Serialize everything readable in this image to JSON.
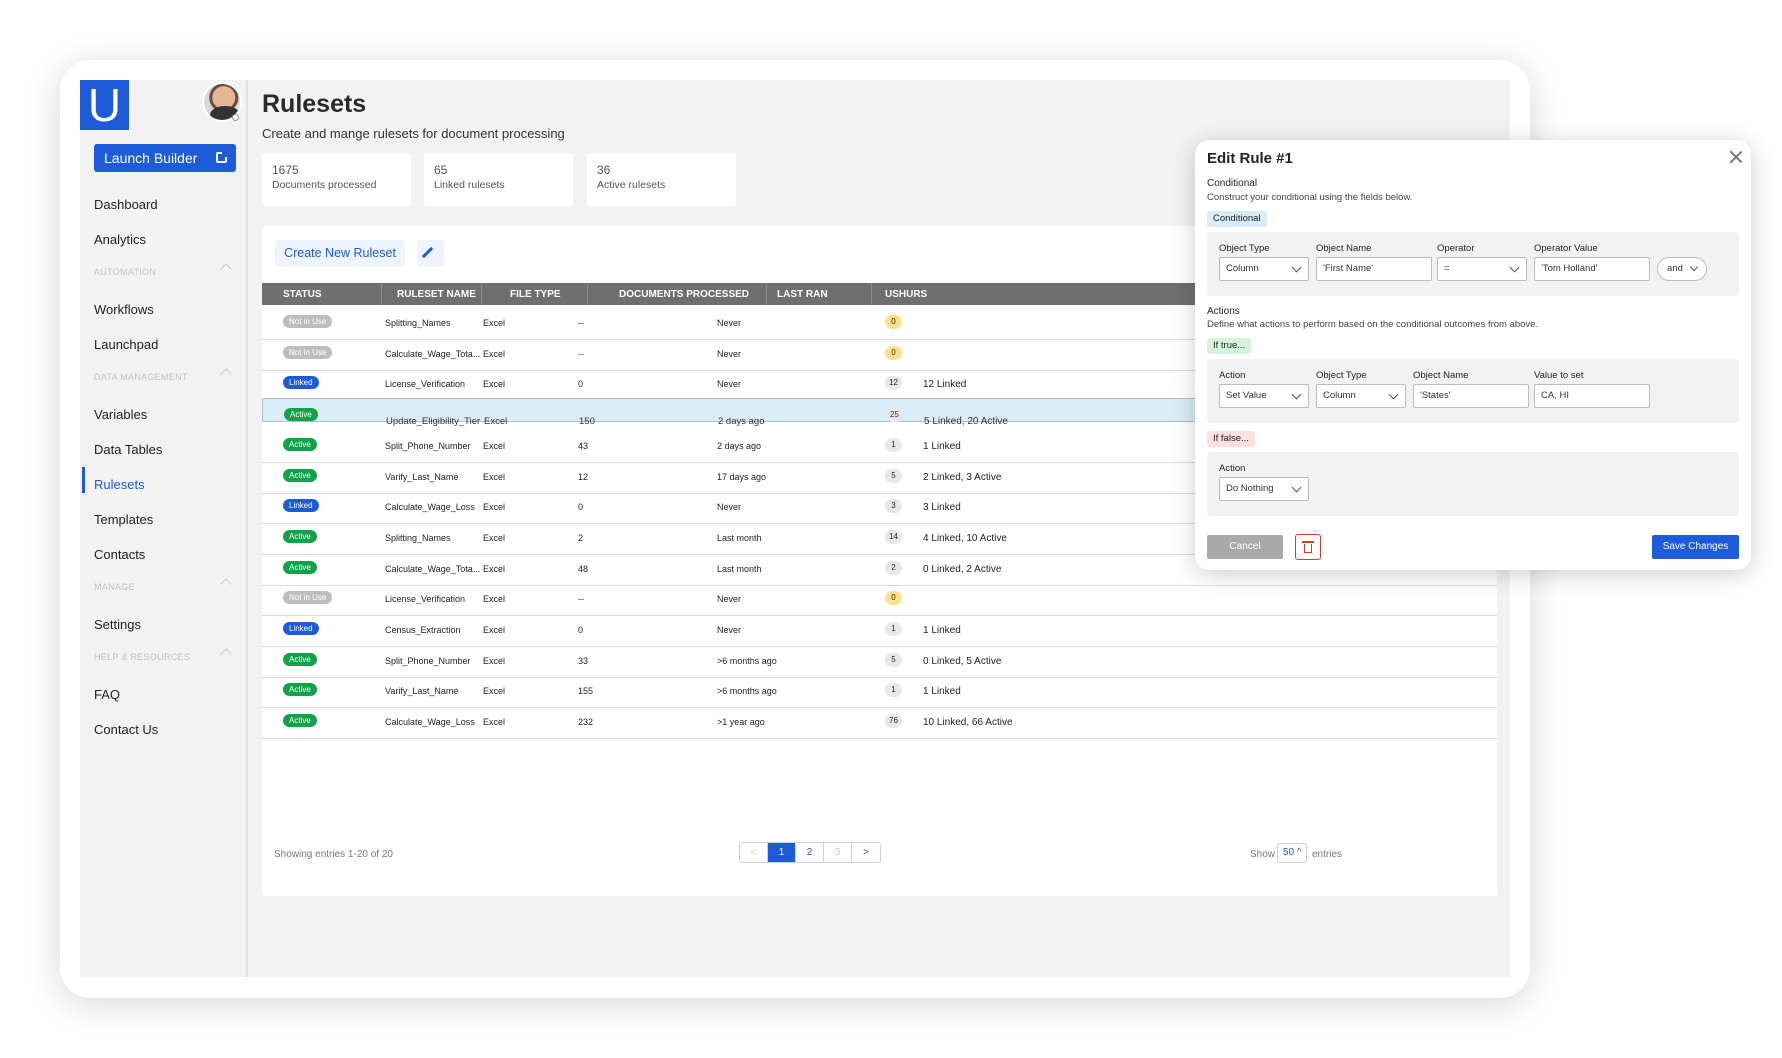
{
  "sidebar": {
    "logo_letter": "U",
    "launch_label": "Launch Builder",
    "items": [
      "Dashboard",
      "Analytics",
      "Workflows",
      "Launchpad",
      "Variables",
      "Data Tables",
      "Rulesets",
      "Templates",
      "Contacts",
      "Settings",
      "FAQ",
      "Contact Us"
    ],
    "sections": [
      "Automation",
      "Data Management",
      "Manage",
      "Help & Resources"
    ],
    "active_item": "Rulesets"
  },
  "main": {
    "title": "Rulesets",
    "subtitle": "Create and mange rulesets for document processing",
    "stats": [
      {
        "value": "1675",
        "label": "Documents processed"
      },
      {
        "value": "65",
        "label": "Linked rulesets"
      },
      {
        "value": "36",
        "label": "Active rulesets"
      }
    ],
    "create_label": "Create New Ruleset"
  },
  "table": {
    "columns": [
      "STATUS",
      "RULESET NAME",
      "FILE TYPE",
      "DOCUMENTS PROCESSED",
      "LAST RAN",
      "USHURS"
    ],
    "rows": [
      {
        "status": "Not in Use",
        "name": "Splitting_Names",
        "type": "Excel",
        "docs": "--",
        "last": "Never",
        "count": "0",
        "linked": ""
      },
      {
        "status": "Not in Use",
        "name": "Calculate_Wage_Tota...",
        "type": "Excel",
        "docs": "--",
        "last": "Never",
        "count": "0",
        "linked": ""
      },
      {
        "status": "Linked",
        "name": "License_Verification",
        "type": "Excel",
        "docs": "0",
        "last": "Never",
        "count": "12",
        "linked": "12 Linked"
      },
      {
        "status": "Active",
        "name": "Update_Eligibility_Tier",
        "type": "Excel",
        "docs": "150",
        "last": "2 days ago",
        "count": "25",
        "linked": "5 Linked, 20 Active",
        "selected": true
      },
      {
        "status": "Active",
        "name": "Split_Phone_Number",
        "type": "Excel",
        "docs": "43",
        "last": "2 days ago",
        "count": "1",
        "linked": "1 Linked"
      },
      {
        "status": "Active",
        "name": "Varify_Last_Name",
        "type": "Excel",
        "docs": "12",
        "last": "17 days ago",
        "count": "5",
        "linked": "2 Linked, 3 Active"
      },
      {
        "status": "Linked",
        "name": "Calculate_Wage_Loss",
        "type": "Excel",
        "docs": "0",
        "last": "Never",
        "count": "3",
        "linked": "3 Linked"
      },
      {
        "status": "Active",
        "name": "Splitting_Names",
        "type": "Excel",
        "docs": "2",
        "last": "Last month",
        "count": "14",
        "linked": "4 Linked, 10 Active"
      },
      {
        "status": "Active",
        "name": "Calculate_Wage_Tota...",
        "type": "Excel",
        "docs": "48",
        "last": "Last month",
        "count": "2",
        "linked": "0 Linked, 2 Active"
      },
      {
        "status": "Not in Use",
        "name": "License_Verification",
        "type": "Excel",
        "docs": "--",
        "last": "Never",
        "count": "0",
        "linked": ""
      },
      {
        "status": "Linked",
        "name": "Census_Extraction",
        "type": "Excel",
        "docs": "0",
        "last": "Never",
        "count": "1",
        "linked": "1 Linked"
      },
      {
        "status": "Active",
        "name": "Split_Phone_Number",
        "type": "Excel",
        "docs": "33",
        "last": ">6 months ago",
        "count": "5",
        "linked": "0 Linked, 5 Active"
      },
      {
        "status": "Active",
        "name": "Varify_Last_Name",
        "type": "Excel",
        "docs": "155",
        "last": ">6 months ago",
        "count": "1",
        "linked": "1 Linked"
      },
      {
        "status": "Active",
        "name": "Calculate_Wage_Loss",
        "type": "Excel",
        "docs": "232",
        "last": ">1 year ago",
        "count": "76",
        "linked": "10 Linked, 66 Active"
      }
    ],
    "footer": {
      "summary": "Showing entries 1-20 of 20",
      "prev": "<",
      "pages": [
        "1",
        "2",
        "3"
      ],
      "next": ">",
      "show_label": "Show",
      "entries_value": "50 ^",
      "entries_label": "entries"
    }
  },
  "modal": {
    "title": "Edit Rule #1",
    "conditional": {
      "heading": "Conditional",
      "description": "Construct your conditional using the fields below.",
      "chip": "Conditional",
      "fields": [
        {
          "label": "Object Type",
          "value": "Column"
        },
        {
          "label": "Object Name",
          "value": "'First Name'"
        },
        {
          "label": "Operator",
          "value": "="
        },
        {
          "label": "Operator Value",
          "value": "'Tom Holland'"
        }
      ],
      "logic": "and"
    },
    "actions": {
      "heading": "Actions",
      "description": "Define what actions to perform based on the conditional outcomes from above.",
      "if_true": {
        "chip": "If true...",
        "fields": [
          {
            "label": "Action",
            "value": "Set Value"
          },
          {
            "label": "Object Type",
            "value": "Column"
          },
          {
            "label": "Object Name",
            "value": "'States'"
          },
          {
            "label": "Value to set",
            "value": "CA, HI"
          }
        ]
      },
      "if_false": {
        "chip": "If false...",
        "fields": [
          {
            "label": "Action",
            "value": "Do Nothing"
          }
        ]
      }
    },
    "cancel_label": "Cancel",
    "save_label": "Save Changes"
  },
  "colors": {
    "brand": "#1e5bd8",
    "active": "#12a24a",
    "linked": "#1e5bd8",
    "not_in_use": "#bdbdbd",
    "selected_row": "#d8edf8"
  }
}
